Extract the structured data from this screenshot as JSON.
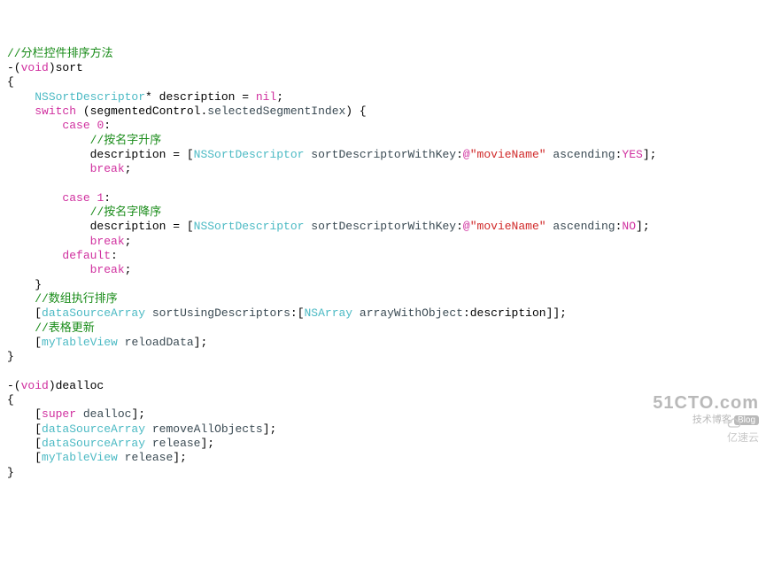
{
  "c": {
    "l01": "//分栏控件排序方法",
    "l02a": "-(",
    "l02b": "void",
    "l02c": ")sort",
    "l03": "{",
    "l04a": "    ",
    "l04b": "NSSortDescriptor",
    "l04c": "* description = ",
    "l04d": "nil",
    "l04e": ";",
    "l05a": "    ",
    "l05b": "switch",
    "l05c": " (segmentedControl.",
    "l05d": "selectedSegmentIndex",
    "l05e": ") {",
    "l06a": "        ",
    "l06b": "case",
    "l06c": " ",
    "l06d": "0",
    "l06e": ":",
    "l07": "            //按名字升序",
    "l08a": "            description = [",
    "l08b": "NSSortDescriptor",
    "l08c": " ",
    "l08d": "sortDescriptorWithKey",
    "l08e": ":",
    "l08f": "@",
    "l08g": "\"movieName\"",
    "l08h": " ",
    "l08i": "ascending",
    "l08j": ":",
    "l08k": "YES",
    "l08l": "];",
    "l09a": "            ",
    "l09b": "break",
    "l09c": ";",
    "l10": "",
    "l11a": "        ",
    "l11b": "case",
    "l11c": " ",
    "l11d": "1",
    "l11e": ":",
    "l12": "            //按名字降序",
    "l13a": "            description = [",
    "l13b": "NSSortDescriptor",
    "l13c": " ",
    "l13d": "sortDescriptorWithKey",
    "l13e": ":",
    "l13f": "@",
    "l13g": "\"movieName\"",
    "l13h": " ",
    "l13i": "ascending",
    "l13j": ":",
    "l13k": "NO",
    "l13l": "];",
    "l14a": "            ",
    "l14b": "break",
    "l14c": ";",
    "l15a": "        ",
    "l15b": "default",
    "l15c": ":",
    "l16a": "            ",
    "l16b": "break",
    "l16c": ";",
    "l17": "    }",
    "l18": "    //数组执行排序",
    "l19a": "    [",
    "l19b": "dataSourceArray",
    "l19c": " ",
    "l19d": "sortUsingDescriptors",
    "l19e": ":[",
    "l19f": "NSArray",
    "l19g": " ",
    "l19h": "arrayWithObject",
    "l19i": ":description]];",
    "l20": "    //表格更新",
    "l21a": "    [",
    "l21b": "myTableView",
    "l21c": " ",
    "l21d": "reloadData",
    "l21e": "];",
    "l22": "}",
    "l23": "",
    "l24a": "-(",
    "l24b": "void",
    "l24c": ")dealloc",
    "l25": "{",
    "l26a": "    [",
    "l26b": "super",
    "l26c": " ",
    "l26d": "dealloc",
    "l26e": "];",
    "l27a": "    [",
    "l27b": "dataSourceArray",
    "l27c": " ",
    "l27d": "removeAllObjects",
    "l27e": "];",
    "l28a": "    [",
    "l28b": "dataSourceArray",
    "l28c": " ",
    "l28d": "release",
    "l28e": "];",
    "l29a": "    [",
    "l29b": "myTableView",
    "l29c": " ",
    "l29d": "release",
    "l29e": "];",
    "l30": "}"
  },
  "wm": {
    "domain": "51CTO.com",
    "tag1": "技术博客",
    "tag2": "Blog",
    "corner": "亿速云"
  }
}
